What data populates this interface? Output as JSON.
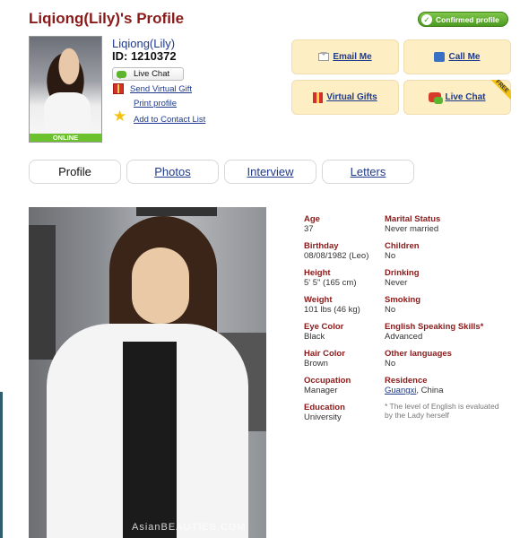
{
  "profile": {
    "title": "Liqiong(Lily)'s Profile",
    "confirmed_label": "Confirmed profile",
    "online_label": "ONLINE",
    "name": "Liqiong(Lily)",
    "id_line": "ID: 1210372",
    "live_chat_label": "Live Chat",
    "send_gift_label": "Send Virtual Gift",
    "print_label": "Print profile",
    "add_contact_label": "Add to Contact List"
  },
  "actions": {
    "email": "Email Me",
    "call": "Call Me",
    "gifts": "Virtual Gifts",
    "chat": "Live Chat",
    "free_badge": "FREE"
  },
  "tabs": [
    "Profile",
    "Photos",
    "Interview",
    "Letters"
  ],
  "photo": {
    "watermark": "AsianBEAUTIES.COM"
  },
  "details": {
    "age": {
      "label": "Age",
      "value": "37"
    },
    "marital": {
      "label": "Marital Status",
      "value": "Never married"
    },
    "birthday": {
      "label": "Birthday",
      "value": "08/08/1982 (Leo)"
    },
    "children": {
      "label": "Children",
      "value": "No"
    },
    "height": {
      "label": "Height",
      "value": "5' 5\" (165 cm)"
    },
    "drinking": {
      "label": "Drinking",
      "value": "Never"
    },
    "weight": {
      "label": "Weight",
      "value": "101 lbs (46 kg)"
    },
    "smoking": {
      "label": "Smoking",
      "value": "No"
    },
    "eye": {
      "label": "Eye Color",
      "value": "Black"
    },
    "english": {
      "label": "English Speaking Skills*",
      "value": "Advanced"
    },
    "hair": {
      "label": "Hair Color",
      "value": "Brown"
    },
    "languages": {
      "label": "Other languages",
      "value": "No"
    },
    "occupation": {
      "label": "Occupation",
      "value": "Manager"
    },
    "residence": {
      "label": "Residence",
      "city": "Guangxi",
      "country": ", China"
    },
    "education": {
      "label": "Education",
      "value": "University"
    },
    "note": "* The level of English is evaluated by the Lady herself"
  },
  "colors": {
    "title": "#8b1a1a",
    "link": "#1f3a8a",
    "button_bg": "#fdeec4",
    "online_green": "#6cc12e"
  }
}
